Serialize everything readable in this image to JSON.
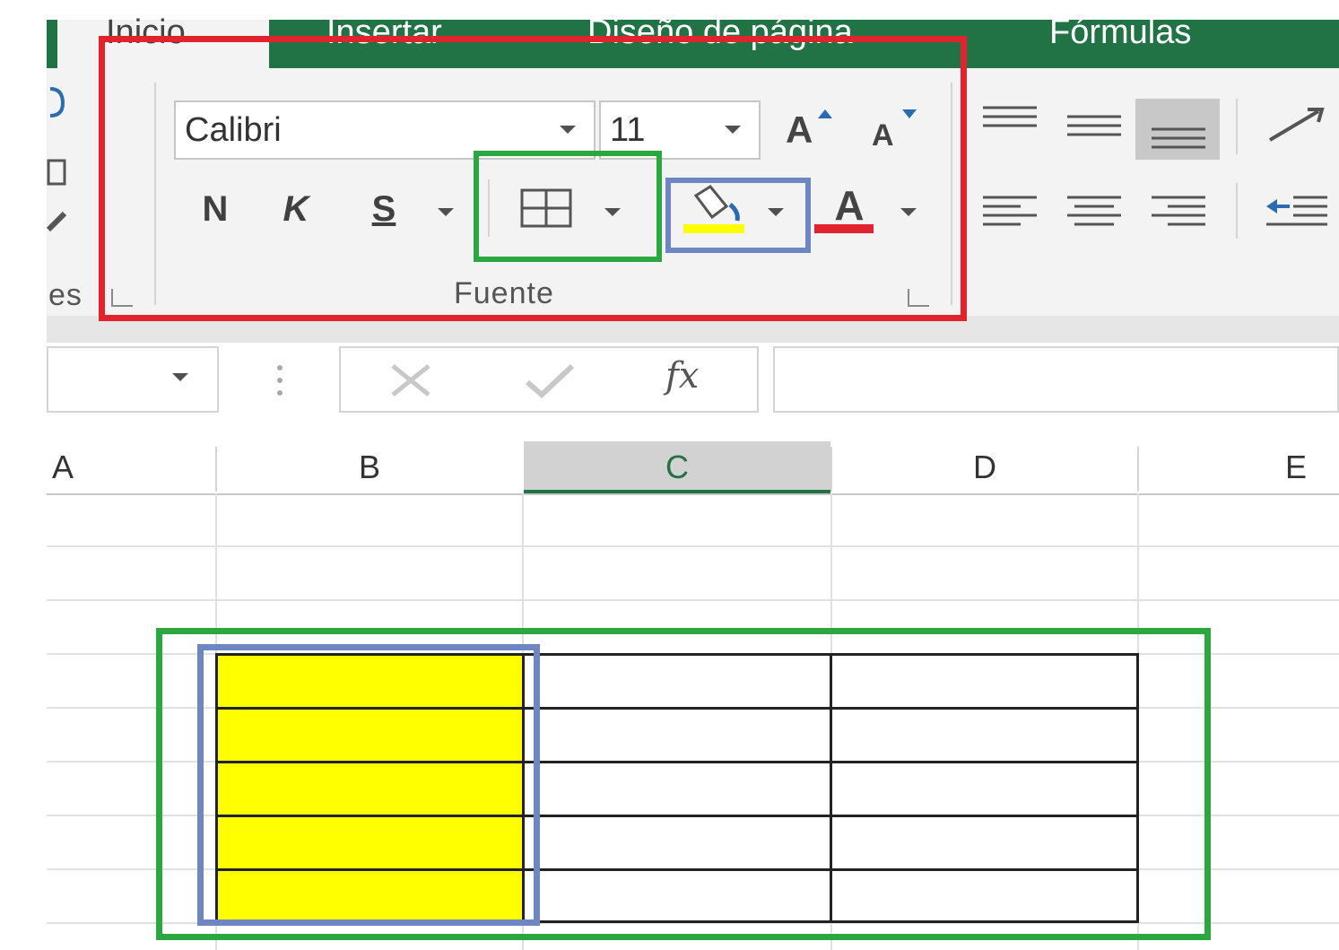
{
  "ribbon": {
    "tabs": [
      {
        "label": "Inicio",
        "active": true
      },
      {
        "label": "Insertar",
        "active": false
      },
      {
        "label": "Diseño de página",
        "active": false
      },
      {
        "label": "Fórmulas",
        "active": false
      }
    ],
    "clipboard_group_label_fragment": "es",
    "font_group": {
      "label": "Fuente",
      "font_name": "Calibri",
      "font_size": "11",
      "grow_font": "A",
      "shrink_font": "A",
      "bold": "N",
      "italic": "K",
      "underline": "S",
      "font_color_glyph": "A",
      "fill_color": "#ffff00",
      "font_color": "#e0232c"
    }
  },
  "formula_bar": {
    "fx_label": "fx",
    "value": ""
  },
  "grid": {
    "columns": [
      "A",
      "B",
      "C",
      "D",
      "E"
    ],
    "selected_column": "C",
    "highlight_color": "#ffff00"
  },
  "annotations": {
    "red": "#e0232c",
    "green": "#2ca640",
    "blue": "#6e86c2"
  }
}
